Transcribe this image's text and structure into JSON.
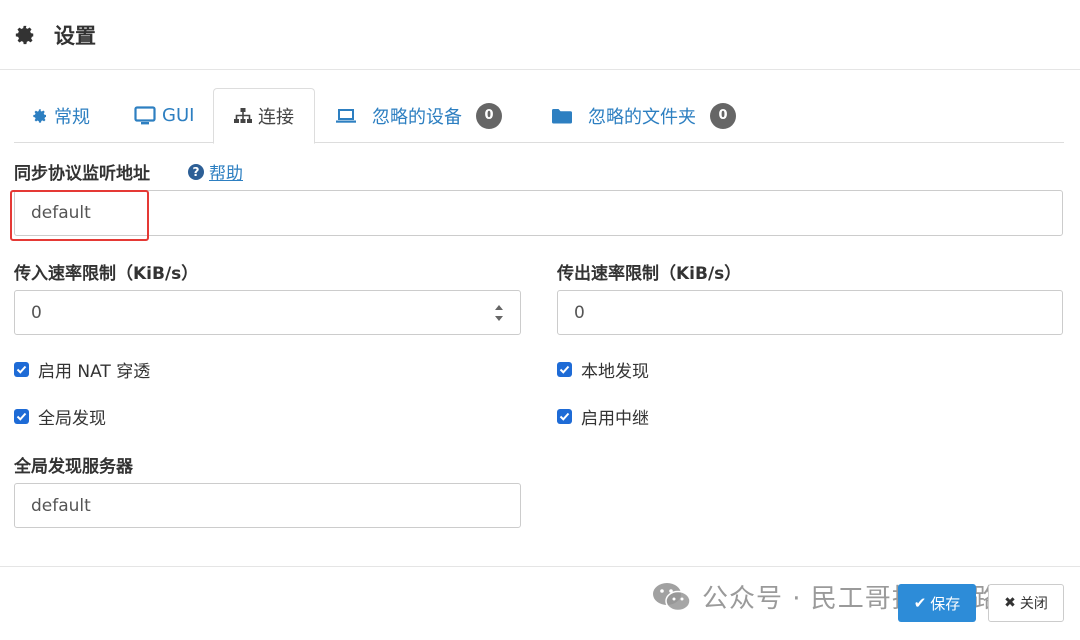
{
  "header": {
    "title": "设置",
    "icon": "gear-icon"
  },
  "tabs": [
    {
      "label": "常规",
      "icon": "gear-icon"
    },
    {
      "label": "GUI",
      "icon": "monitor-icon"
    },
    {
      "label": "连接",
      "icon": "sitemap-icon",
      "active": true
    },
    {
      "label": "忽略的设备",
      "icon": "laptop-icon",
      "badge": "0"
    },
    {
      "label": "忽略的文件夹",
      "icon": "folder-icon",
      "badge": "0"
    }
  ],
  "sync_listen": {
    "label": "同步协议监听地址",
    "help": "帮助",
    "value": "default"
  },
  "incoming_rate": {
    "label": "传入速率限制（KiB/s）",
    "value": "0"
  },
  "outgoing_rate": {
    "label": "传出速率限制（KiB/s）",
    "value": "0"
  },
  "checkboxes": {
    "nat": {
      "label": "启用 NAT 穿透",
      "checked": true
    },
    "local": {
      "label": "本地发现",
      "checked": true
    },
    "global": {
      "label": "全局发现",
      "checked": true
    },
    "relay": {
      "label": "启用中继",
      "checked": true
    }
  },
  "global_server": {
    "label": "全局发现服务器",
    "value": "default"
  },
  "footer": {
    "save": "保存",
    "close": "关闭"
  },
  "watermark": "公众号 · 民工哥技术之路",
  "colors": {
    "accent": "#2d7fc1",
    "save": "#2d8cd8",
    "highlight": "#e53935",
    "badge": "#666666"
  }
}
